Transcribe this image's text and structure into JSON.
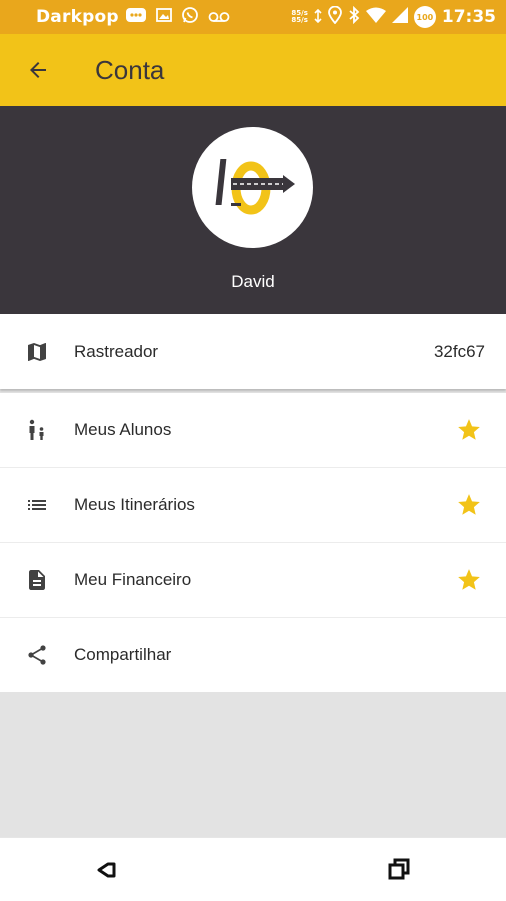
{
  "status_bar": {
    "carrier": "Darkpop",
    "net_speed_up": "85/s",
    "net_speed_down": "85/s",
    "battery": "100",
    "time": "17:35",
    "icons": [
      "chat-bubble-icon",
      "image-icon",
      "whatsapp-icon",
      "voicemail-icon",
      "location-icon",
      "bluetooth-icon",
      "wifi-icon",
      "signal-icon",
      "battery-icon"
    ]
  },
  "toolbar": {
    "title": "Conta",
    "back_icon": "arrow-back-icon"
  },
  "profile": {
    "name": "David",
    "avatar_icon": "app-logo-icon"
  },
  "tracker": {
    "label": "Rastreador",
    "value": "32fc67",
    "icon": "map-icon"
  },
  "menu": {
    "items": [
      {
        "label": "Meus Alunos",
        "icon": "students-icon",
        "starred": true
      },
      {
        "label": "Meus Itinerários",
        "icon": "list-icon",
        "starred": true
      },
      {
        "label": "Meu Financeiro",
        "icon": "document-icon",
        "starred": true
      },
      {
        "label": "Compartilhar",
        "icon": "share-icon",
        "starred": false
      }
    ]
  },
  "colors": {
    "status_bar": "#e9a71c",
    "toolbar": "#f2c318",
    "profile_bg": "#3a363c",
    "star": "#f2c318"
  }
}
